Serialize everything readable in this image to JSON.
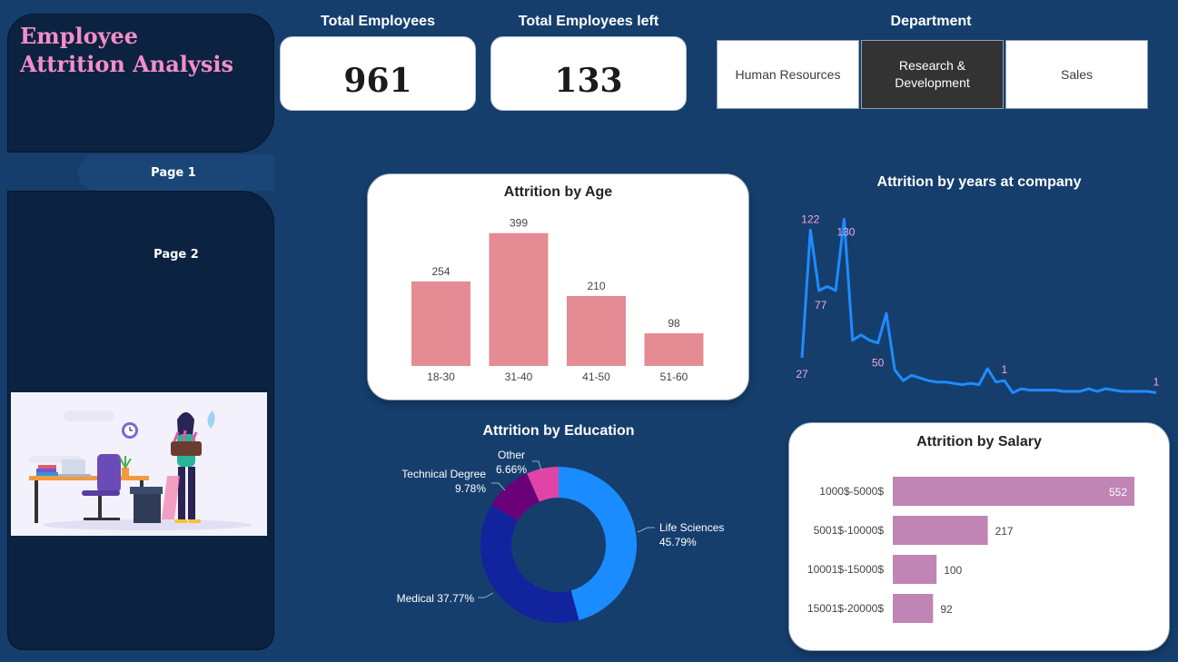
{
  "app": {
    "title_line1": "Employee",
    "title_line2": "Attrition Analysis"
  },
  "nav": {
    "page1": "Page 1",
    "page2": "Page 2"
  },
  "kpis": {
    "total_employees_label": "Total Employees",
    "total_employees_value": "961",
    "employees_left_label": "Total Employees left",
    "employees_left_value": "133"
  },
  "department": {
    "label": "Department",
    "options": [
      "Human Resources",
      "Research & Development",
      "Sales"
    ],
    "selected": "Research & Development"
  },
  "colors": {
    "background": "#153e6d",
    "sidebar": "#0b2240",
    "title_pink": "#f38ec9",
    "age_bar": "#e48b93",
    "line": "#1e8cff",
    "line_label": "#f0a8d8",
    "salary_bar": "#c084b5",
    "donut": [
      "#1a8cff",
      "#12239e",
      "#6b007b",
      "#e044a7"
    ]
  },
  "chart_data": [
    {
      "type": "bar",
      "title": "Attrition by Age",
      "categories": [
        "18-30",
        "31-40",
        "41-50",
        "51-60"
      ],
      "values": [
        254,
        399,
        210,
        98
      ],
      "ylim": [
        0,
        420
      ]
    },
    {
      "type": "line",
      "title": "Attrition by years at company",
      "values": [
        27,
        122,
        77,
        80,
        77,
        130,
        40,
        44,
        40,
        38,
        60,
        18,
        10,
        14,
        12,
        10,
        9,
        9,
        8,
        7,
        8,
        7,
        19,
        9,
        10,
        1,
        4,
        3,
        3,
        3,
        3,
        2,
        2,
        2,
        4,
        2,
        4,
        3,
        2,
        2,
        2,
        2,
        1
      ],
      "labels": [
        {
          "index": 0,
          "text": "27"
        },
        {
          "index": 1,
          "text": "122"
        },
        {
          "index": 2,
          "text": "77"
        },
        {
          "index": 5,
          "text": "130"
        },
        {
          "index": 9,
          "text": "50"
        },
        {
          "index": 24,
          "text": "1"
        },
        {
          "index": 42,
          "text": "1"
        }
      ],
      "ylim": [
        0,
        135
      ]
    },
    {
      "type": "pie",
      "title": "Attrition by Education",
      "slices": [
        {
          "name": "Life Sciences",
          "value": 45.79,
          "label": "45.79%"
        },
        {
          "name": "Medical",
          "value": 37.77,
          "label": "37.77%"
        },
        {
          "name": "Technical Degree",
          "value": 9.78,
          "label": "9.78%"
        },
        {
          "name": "Other",
          "value": 6.66,
          "label": "6.66%"
        }
      ]
    },
    {
      "type": "bar",
      "orientation": "horizontal",
      "title": "Attrition by Salary",
      "categories": [
        "1000$-5000$",
        "5001$-10000$",
        "10001$-15000$",
        "15001$-20000$"
      ],
      "values": [
        552,
        217,
        100,
        92
      ],
      "xlim": [
        0,
        560
      ]
    }
  ]
}
